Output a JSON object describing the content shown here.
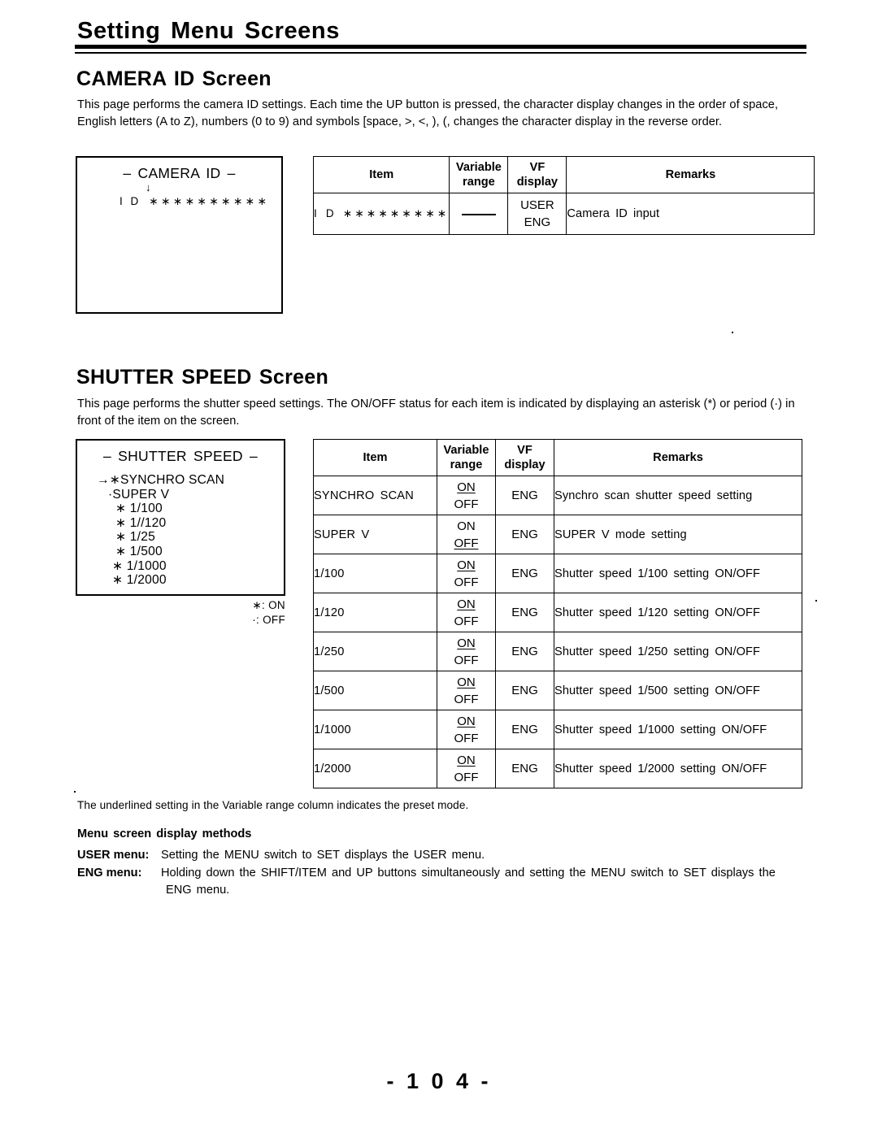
{
  "document": {
    "page_title": "Setting Menu Screens",
    "page_number": "- 1 0 4 -"
  },
  "sections": [
    {
      "heading": "CAMERA ID Screen",
      "intro": "This page performs the camera ID settings. Each time the UP button is pressed, the character display changes in the order of space, English letters (A to Z), numbers (0 to 9) and symbols [space, >, <, ), (, changes the character display in the reverse order.",
      "screen": {
        "title": "–  CAMERA  ID  –",
        "arrow_glyph": "↓",
        "id_label": "I D",
        "id_stars": "∗∗∗∗∗∗∗∗∗∗"
      },
      "table": {
        "headers": {
          "item": "Item",
          "range_line1": "Variable",
          "range_line2": "range",
          "vf_line1": "VF",
          "vf_line2": "display",
          "remarks": "Remarks"
        },
        "rows": [
          {
            "item_label": "I D",
            "item_stars": "∗∗∗∗∗∗∗∗∗",
            "range_type": "dash",
            "range_on": "",
            "range_off": "",
            "vf_line1": "USER",
            "vf_line2": "ENG",
            "remarks": "Camera ID input"
          }
        ]
      }
    },
    {
      "heading": "SHUTTER SPEED Screen",
      "intro": "This page performs the shutter speed settings. The ON/OFF status for each item is indicated by displaying an asterisk (*) or period (·) in front of the item on the screen.",
      "screen": {
        "title": "–  SHUTTER  SPEED  –",
        "items": [
          "→∗SYNCHRO  SCAN",
          "·SUPER V",
          "∗ 1/100",
          "∗ 1//120",
          "∗ 1/25",
          "∗ 1/500",
          "∗ 1/1000",
          "∗ 1/2000"
        ],
        "legend_on": "∗: ON",
        "legend_off": "·: OFF"
      },
      "table": {
        "headers": {
          "item": "Item",
          "range_line1": "Variable",
          "range_line2": "range",
          "vf_line1": "VF",
          "vf_line2": "display",
          "remarks": "Remarks"
        },
        "rows": [
          {
            "item": "SYNCHRO  SCAN",
            "range_on": "ON",
            "range_off": "OFF",
            "preset": "ON",
            "vf": "ENG",
            "remarks": "Synchro  scan  shutter  speed  setting"
          },
          {
            "item": "SUPER  V",
            "range_on": "ON",
            "range_off": "OFF",
            "preset": "OFF",
            "vf": "ENG",
            "remarks": "SUPER  V  mode  setting"
          },
          {
            "item": "1/100",
            "range_on": "ON",
            "range_off": "OFF",
            "preset": "ON",
            "vf": "ENG",
            "remarks": "Shutter  speed  1/100  setting  ON/OFF"
          },
          {
            "item": "1/120",
            "range_on": "ON",
            "range_off": "OFF",
            "preset": "ON",
            "vf": "ENG",
            "remarks": "Shutter  speed  1/120  setting  ON/OFF"
          },
          {
            "item": "1/250",
            "range_on": "ON",
            "range_off": "OFF",
            "preset": "ON",
            "vf": "ENG",
            "remarks": "Shutter  speed  1/250  setting  ON/OFF"
          },
          {
            "item": "1/500",
            "range_on": "ON",
            "range_off": "OFF",
            "preset": "ON",
            "vf": "ENG",
            "remarks": "Shutter  speed  1/500  setting  ON/OFF"
          },
          {
            "item": "1/1000",
            "range_on": "ON",
            "range_off": "OFF",
            "preset": "ON",
            "vf": "ENG",
            "remarks": "Shutter  speed  1/1000  setting  ON/OFF"
          },
          {
            "item": "1/2000",
            "range_on": "ON",
            "range_off": "OFF",
            "preset": "ON",
            "vf": "ENG",
            "remarks": "Shutter  speed  1/2000  setting  ON/OFF"
          }
        ]
      }
    }
  ],
  "footnotes": {
    "preset_note": "The underlined setting in the Variable range column indicates the preset mode.",
    "methods_heading": "Menu screen display methods",
    "user_label": "USER menu:",
    "user_text": "Setting the MENU switch to SET displays the USER menu.",
    "eng_label": "ENG  menu:",
    "eng_text": "Holding down the SHIFT/ITEM and UP buttons simultaneously and setting the MENU switch to SET displays the",
    "eng_text_cont": "ENG menu."
  }
}
